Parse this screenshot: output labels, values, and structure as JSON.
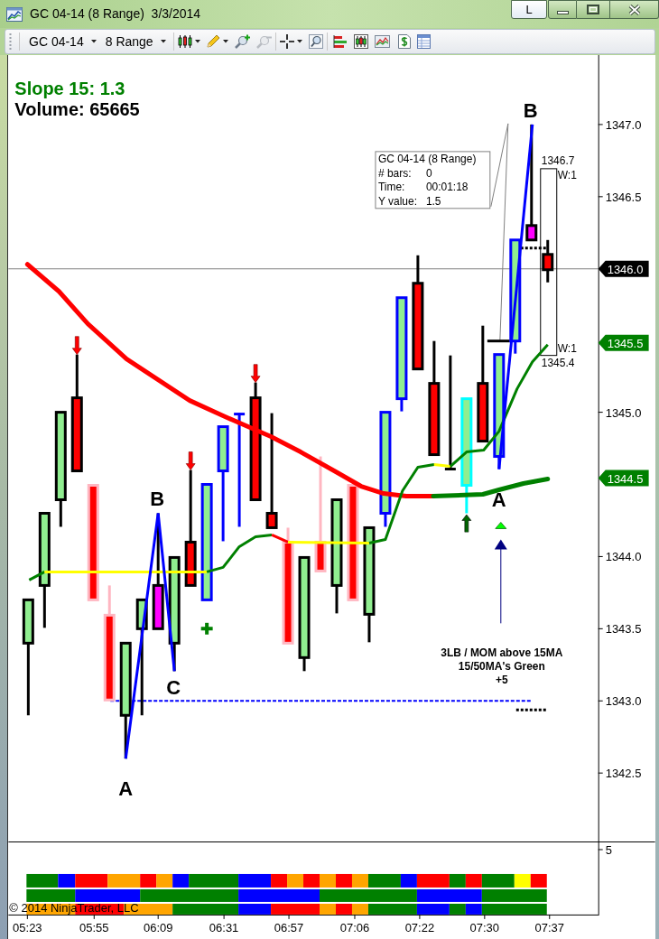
{
  "window": {
    "title": "GC 04-14 (8 Range)  3/3/2014",
    "pin_button": "L"
  },
  "toolbar": {
    "instrument": "GC 04-14",
    "bar_type": "8 Range"
  },
  "chart": {
    "indicators": [
      {
        "label": "Slope 15: 1.3",
        "color": "#008000"
      },
      {
        "label": "Volume: 65665",
        "color": "#000000"
      }
    ],
    "wave_labels": [
      "B",
      "B",
      "A",
      "C",
      "A"
    ],
    "tooltip": {
      "title": "GC 04-14 (8 Range)",
      "rows": [
        {
          "label": "# bars:",
          "value": "0"
        },
        {
          "label": "Time:",
          "value": "00:01:18"
        },
        {
          "label": "Y value:",
          "value": "1.5"
        }
      ]
    },
    "measure": {
      "high": "1346.7",
      "top_width": "W:1",
      "bottom_width": "W:1",
      "low": "1345.4"
    },
    "annotation": [
      "3LB / MOM above 15MA",
      "15/50MA's Green",
      "+5"
    ],
    "y_axis": [
      "1347.0",
      "1346.5",
      "1345.0",
      "1344.0",
      "1343.5",
      "1343.0",
      "1342.5"
    ],
    "price_tags": [
      {
        "label": "1346.0",
        "color": "#000000"
      },
      {
        "label": "1345.5",
        "color": "#008000"
      },
      {
        "label": "1344.5",
        "color": "#008000"
      }
    ]
  },
  "lower_panel": {
    "y_axis": [
      "5"
    ],
    "copyright": "© 2014 NinjaTrader, LLC"
  },
  "x_axis": [
    "05:23",
    "05:55",
    "06:09",
    "06:31",
    "06:57",
    "07:06",
    "07:22",
    "07:30",
    "07:37"
  ]
}
